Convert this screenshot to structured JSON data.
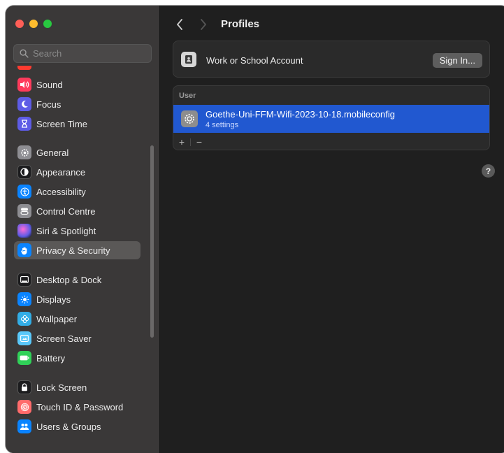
{
  "search": {
    "placeholder": "Search"
  },
  "sidebar": {
    "items": [
      {
        "label": "Sound",
        "icon": "speaker-icon",
        "color": "#ff3b5c"
      },
      {
        "label": "Focus",
        "icon": "moon-icon",
        "color": "#5e5ce6"
      },
      {
        "label": "Screen Time",
        "icon": "hourglass-icon",
        "color": "#5e5ce6"
      },
      {
        "label": "General",
        "icon": "gear-icon",
        "color": "#8e8e93"
      },
      {
        "label": "Appearance",
        "icon": "appearance-icon",
        "color": "#1c1c1e"
      },
      {
        "label": "Accessibility",
        "icon": "accessibility-icon",
        "color": "#0a84ff"
      },
      {
        "label": "Control Centre",
        "icon": "control-centre-icon",
        "color": "#8e8e93"
      },
      {
        "label": "Siri & Spotlight",
        "icon": "siri-icon",
        "color": "#bf5af2"
      },
      {
        "label": "Privacy & Security",
        "icon": "hand-icon",
        "color": "#0a84ff"
      },
      {
        "label": "Desktop & Dock",
        "icon": "dock-icon",
        "color": "#1c1c1e"
      },
      {
        "label": "Displays",
        "icon": "sun-icon",
        "color": "#0a84ff"
      },
      {
        "label": "Wallpaper",
        "icon": "flower-icon",
        "color": "#32ade6"
      },
      {
        "label": "Screen Saver",
        "icon": "screen-saver-icon",
        "color": "#5ac8fa"
      },
      {
        "label": "Battery",
        "icon": "battery-icon",
        "color": "#30d158"
      },
      {
        "label": "Lock Screen",
        "icon": "lock-icon",
        "color": "#1c1c1e"
      },
      {
        "label": "Touch ID & Password",
        "icon": "fingerprint-icon",
        "color": "#ff6b6b"
      },
      {
        "label": "Users & Groups",
        "icon": "users-icon",
        "color": "#0a84ff"
      }
    ]
  },
  "header": {
    "title": "Profiles"
  },
  "account": {
    "label": "Work or School Account",
    "button": "Sign In..."
  },
  "profiles": {
    "section": "User",
    "items": [
      {
        "name": "Goethe-Uni-FFM-Wifi-2023-10-18.mobileconfig",
        "detail": "4 settings"
      }
    ],
    "add": "+",
    "remove": "−"
  },
  "help": "?",
  "colors": {
    "selection": "#2158d0",
    "sidebar_bg": "#3a3838",
    "main_bg": "#1f1f1f"
  }
}
